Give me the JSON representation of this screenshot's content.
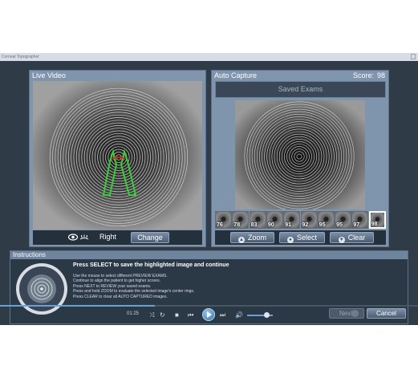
{
  "window": {
    "title": "Corneal Topographer"
  },
  "live_video": {
    "title": "Live Video",
    "side_label": "Right",
    "change_label": "Change"
  },
  "auto_capture": {
    "title": "Auto Capture",
    "score_label": "Score:",
    "score_value": "98",
    "saved_exams_label": "Saved Exams",
    "thumbnails": [
      "76",
      "78",
      "83",
      "90",
      "91",
      "92",
      "95",
      "95",
      "97",
      "98"
    ],
    "selected_index": 9,
    "zoom_label": "Zoom",
    "select_label": "Select",
    "clear_label": "Clear"
  },
  "instructions": {
    "title": "Instructions",
    "heading": "Press SELECT to save the highlighted image and continue",
    "lines": [
      "Use the mouse to select different PREVIEW EXAMS.",
      "Continue to align the patient to get higher scores.",
      "Press NEXT to REVIEW your saved exams.",
      "Press and hold ZOOM to evaluate the selected image's center rings.",
      "Press CLEAR to clear all AUTO CAPTURED images."
    ],
    "next_label": "Next",
    "cancel_label": "Cancel"
  },
  "media_player": {
    "time": "01:25",
    "progress": 0.37,
    "volume": 0.75
  },
  "colors": {
    "app_bg": "#303b48",
    "panel": "#7f95ad",
    "reticle": "#2bd62b",
    "marker": "#e02020"
  }
}
